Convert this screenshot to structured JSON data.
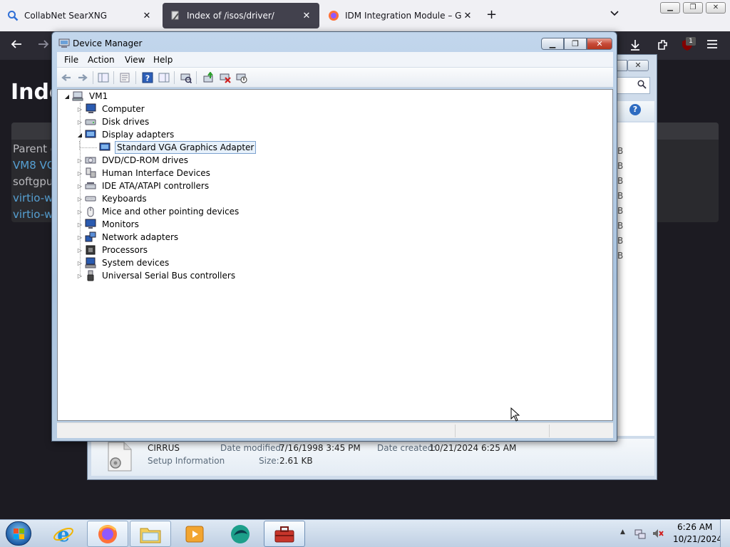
{
  "browser": {
    "tabs": [
      {
        "title": "CollabNet SearXNG",
        "active": false
      },
      {
        "title": "Index of /isos/driver/",
        "active": true
      },
      {
        "title": "IDM Integration Module – Get t",
        "active": false
      }
    ],
    "new_tab_glyph": "+",
    "list_all_glyph": "❯",
    "notification_badge": "1",
    "page": {
      "heading_fragment": "Inde",
      "links": [
        "Parent d",
        "VM8 VC",
        "softgpu",
        "virtio-w",
        "virtio-w"
      ]
    }
  },
  "explorer": {
    "size_fragments": [
      "B",
      "B",
      "B",
      "B",
      "B",
      "B",
      "B",
      "B"
    ],
    "details": {
      "file_name": "CIRRUS",
      "file_type": "Setup Information",
      "modified_label": "Date modified:",
      "modified_value": "7/16/1998 3:45 PM",
      "created_label": "Date created:",
      "created_value": "10/21/2024 6:25 AM",
      "size_label": "Size:",
      "size_value": "2.61 KB"
    }
  },
  "device_manager": {
    "title": "Device Manager",
    "menu": [
      "File",
      "Action",
      "View",
      "Help"
    ],
    "tree": {
      "root": "VM1",
      "categories": [
        {
          "label": "Computer",
          "icon": "computer-icon",
          "expanded": false
        },
        {
          "label": "Disk drives",
          "icon": "disk-drive-icon",
          "expanded": false
        },
        {
          "label": "Display adapters",
          "icon": "display-adapter-icon",
          "expanded": true,
          "children": [
            {
              "label": "Standard VGA Graphics Adapter",
              "icon": "display-adapter-icon",
              "selected": true
            }
          ]
        },
        {
          "label": "DVD/CD-ROM drives",
          "icon": "dvd-drive-icon",
          "expanded": false
        },
        {
          "label": "Human Interface Devices",
          "icon": "hid-icon",
          "expanded": false
        },
        {
          "label": "IDE ATA/ATAPI controllers",
          "icon": "ide-controller-icon",
          "expanded": false
        },
        {
          "label": "Keyboards",
          "icon": "keyboard-icon",
          "expanded": false
        },
        {
          "label": "Mice and other pointing devices",
          "icon": "mouse-icon",
          "expanded": false
        },
        {
          "label": "Monitors",
          "icon": "monitor-icon",
          "expanded": false
        },
        {
          "label": "Network adapters",
          "icon": "network-adapter-icon",
          "expanded": false
        },
        {
          "label": "Processors",
          "icon": "processor-icon",
          "expanded": false
        },
        {
          "label": "System devices",
          "icon": "system-devices-icon",
          "expanded": false
        },
        {
          "label": "Universal Serial Bus controllers",
          "icon": "usb-icon",
          "expanded": false
        }
      ]
    }
  },
  "taskbar": {
    "apps": [
      "internet-explorer-icon",
      "firefox-icon",
      "file-explorer-icon",
      "media-player-icon",
      "app-icon",
      "device-manager-icon"
    ],
    "clock_time": "6:26 AM",
    "clock_date": "10/21/2024"
  },
  "colors": {
    "tab_active": "#42414d",
    "selection_border": "#7da2ce",
    "close_red": "#c74a38"
  }
}
